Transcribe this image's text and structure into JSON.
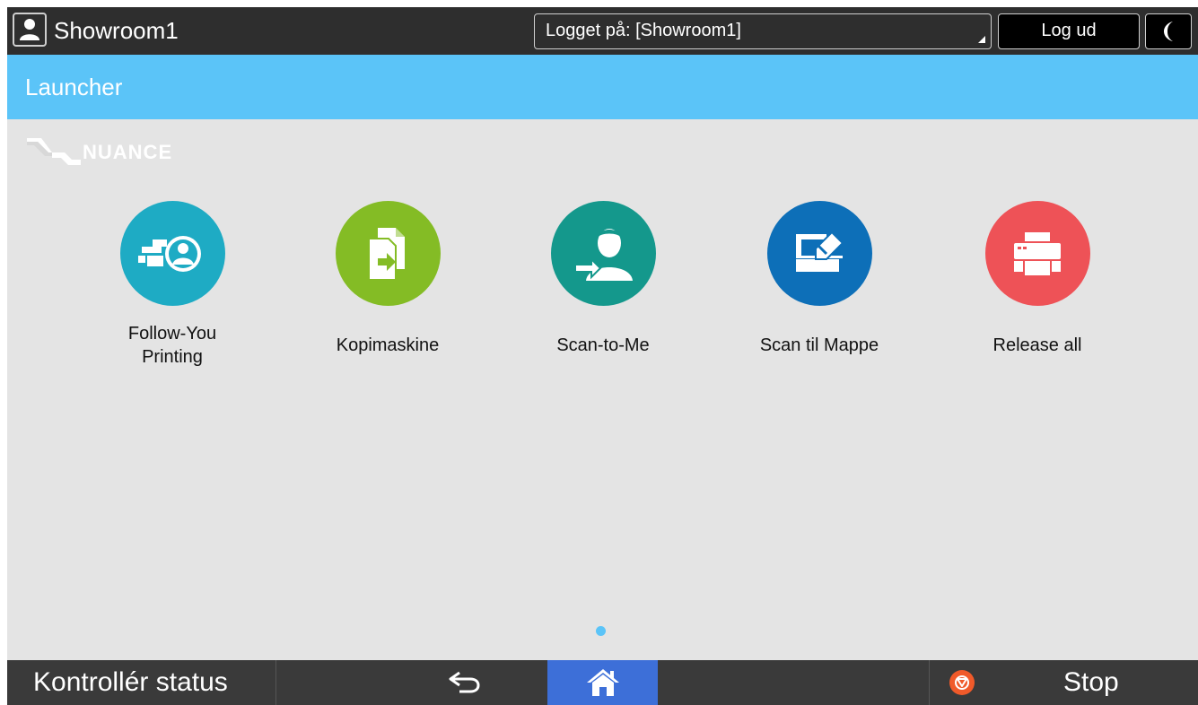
{
  "topbar": {
    "user_name": "Showroom1",
    "login_status": "Logget på: [Showroom1]",
    "logout_label": "Log ud"
  },
  "title": "Launcher",
  "logo": {
    "text": "NUANCE"
  },
  "apps": [
    {
      "label_lines": [
        "Follow-You",
        "Printing"
      ],
      "color": "#1eabc4",
      "icon": "follow-you-printing-icon"
    },
    {
      "label_lines": [
        "Kopimaskine"
      ],
      "color": "#84bc25",
      "icon": "copy-documents-icon"
    },
    {
      "label_lines": [
        "Scan-to-Me"
      ],
      "color": "#14988c",
      "icon": "scan-to-me-icon"
    },
    {
      "label_lines": [
        "Scan til Mappe"
      ],
      "color": "#0d6fb8",
      "icon": "scanner-icon"
    },
    {
      "label_lines": [
        "Release all"
      ],
      "color": "#ee5257",
      "icon": "printer-icon"
    }
  ],
  "bottombar": {
    "status_label": "Kontrollér status",
    "stop_label": "Stop"
  },
  "colors": {
    "accent": "#5bc4f8",
    "home": "#3d6fd8",
    "stop": "#f05a2a"
  }
}
